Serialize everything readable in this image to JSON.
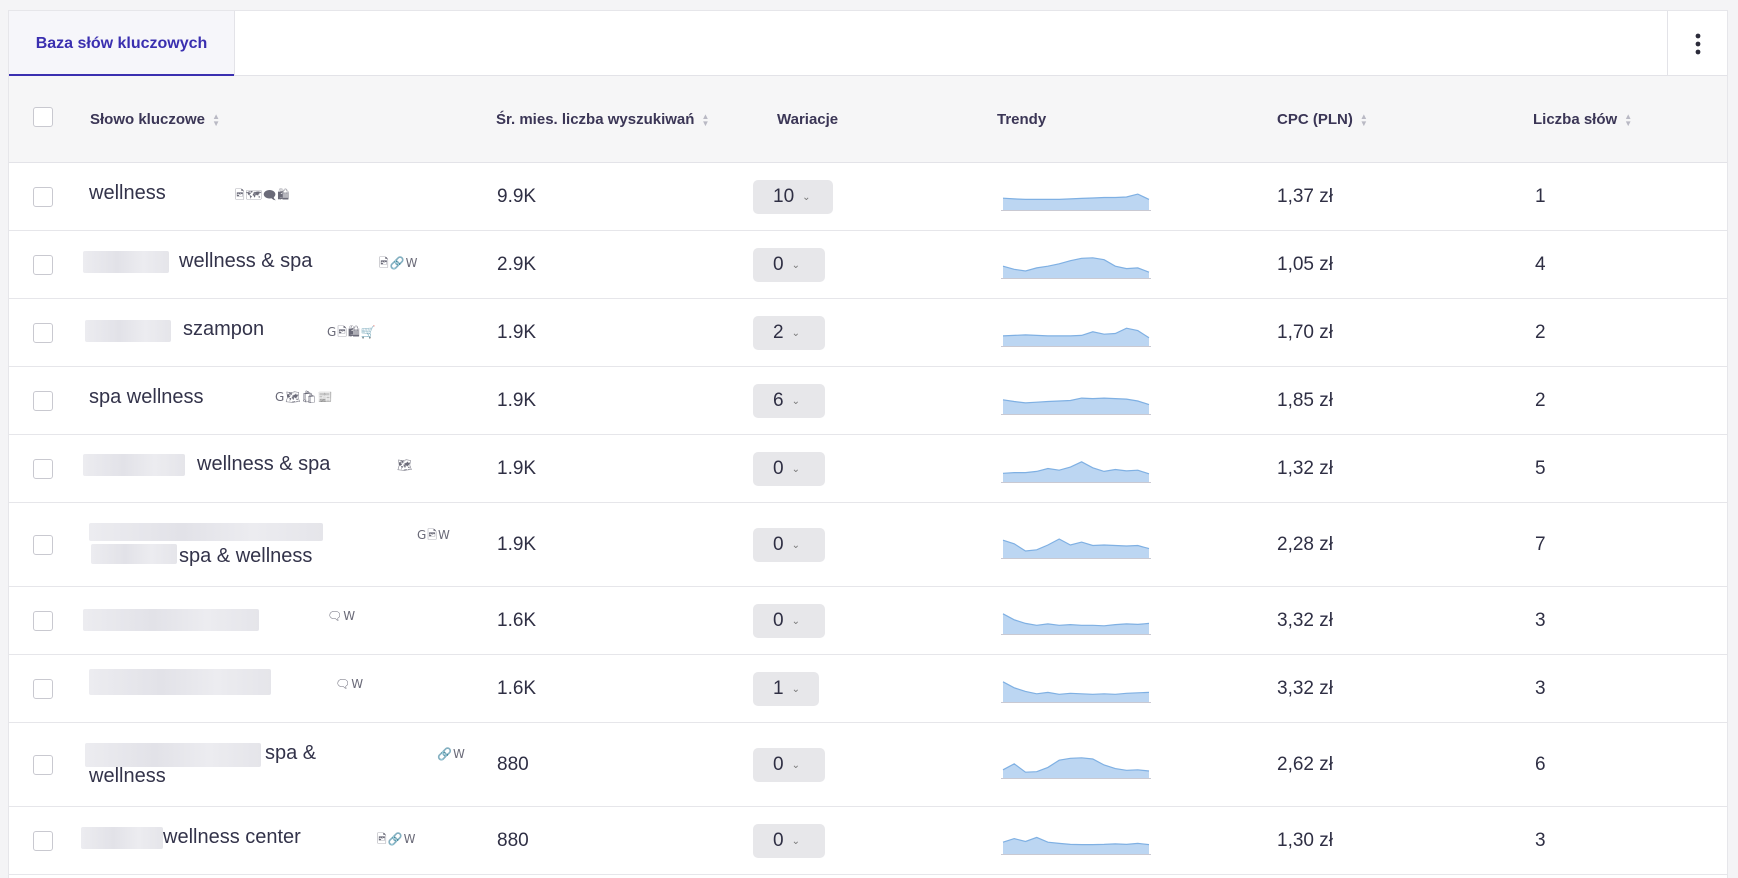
{
  "tab": {
    "label": "Baza słów kluczowych"
  },
  "columns": {
    "keyword": "Słowo kluczowe",
    "volume": "Śr. mies. liczba wyszukiwań",
    "variations": "Wariacje",
    "trends": "Trendy",
    "cpc": "CPC (PLN)",
    "words": "Liczba słów"
  },
  "colors": {
    "accent": "#3a2fb0",
    "trend_fill": "#bcd6f2",
    "trend_line": "#7fb0e3"
  },
  "rows": [
    {
      "keyword": "wellness",
      "icons": "🖻🗺🗨🛍",
      "volume": "9.9K",
      "variations": "10",
      "cpc": "1,37 zł",
      "words": "1",
      "trend": [
        0.45,
        0.42,
        0.4,
        0.4,
        0.4,
        0.4,
        0.42,
        0.44,
        0.46,
        0.48,
        0.48,
        0.5,
        0.62,
        0.4
      ]
    },
    {
      "keyword": "wellness & spa",
      "icons": "🖻🔗W",
      "volume": "2.9K",
      "variations": "0",
      "cpc": "1,05 zł",
      "words": "4",
      "trend": [
        0.45,
        0.32,
        0.25,
        0.38,
        0.45,
        0.55,
        0.68,
        0.78,
        0.8,
        0.72,
        0.45,
        0.35,
        0.38,
        0.2
      ]
    },
    {
      "keyword": "szampon",
      "icons": "G🖻🛍🛒",
      "volume": "1.9K",
      "variations": "2",
      "cpc": "1,70 zł",
      "words": "2",
      "trend": [
        0.38,
        0.4,
        0.42,
        0.4,
        0.38,
        0.38,
        0.38,
        0.4,
        0.55,
        0.45,
        0.48,
        0.7,
        0.6,
        0.3
      ]
    },
    {
      "keyword": "spa wellness",
      "icons": "G🗺🛍📰",
      "volume": "1.9K",
      "variations": "6",
      "cpc": "1,85 zł",
      "words": "2",
      "trend": [
        0.55,
        0.48,
        0.42,
        0.45,
        0.48,
        0.5,
        0.52,
        0.62,
        0.6,
        0.62,
        0.6,
        0.58,
        0.5,
        0.35
      ]
    },
    {
      "keyword": "wellness & spa",
      "icons": "🗺",
      "volume": "1.9K",
      "variations": "0",
      "cpc": "1,32 zł",
      "words": "5",
      "trend": [
        0.32,
        0.35,
        0.35,
        0.4,
        0.52,
        0.45,
        0.58,
        0.8,
        0.55,
        0.4,
        0.48,
        0.42,
        0.45,
        0.3
      ]
    },
    {
      "keyword": "spa & wellness",
      "icons": "G🖻W",
      "volume": "1.9K",
      "variations": "0",
      "cpc": "2,28 zł",
      "words": "7",
      "trend": [
        0.7,
        0.55,
        0.25,
        0.3,
        0.5,
        0.75,
        0.5,
        0.62,
        0.48,
        0.5,
        0.48,
        0.46,
        0.48,
        0.35
      ]
    },
    {
      "keyword": "",
      "icons": "🗨W",
      "volume": "1.6K",
      "variations": "0",
      "cpc": "3,32 zł",
      "words": "3",
      "trend": [
        0.8,
        0.55,
        0.4,
        0.32,
        0.38,
        0.32,
        0.35,
        0.32,
        0.32,
        0.3,
        0.35,
        0.38,
        0.36,
        0.4
      ]
    },
    {
      "keyword": "",
      "icons": "🗨W",
      "volume": "1.6K",
      "variations": "1",
      "cpc": "3,32 zł",
      "words": "3",
      "trend": [
        0.8,
        0.55,
        0.4,
        0.3,
        0.36,
        0.28,
        0.32,
        0.3,
        0.28,
        0.3,
        0.28,
        0.32,
        0.34,
        0.36
      ]
    },
    {
      "keyword": "spa & wellness",
      "icons": "🔗W",
      "volume": "880",
      "variations": "0",
      "cpc": "2,62 zł",
      "words": "6",
      "trend": [
        0.3,
        0.55,
        0.2,
        0.22,
        0.4,
        0.7,
        0.78,
        0.8,
        0.75,
        0.5,
        0.35,
        0.28,
        0.3,
        0.25
      ]
    },
    {
      "keyword": "wellness center",
      "icons": "🖻🔗W",
      "volume": "880",
      "variations": "0",
      "cpc": "1,30 zł",
      "words": "3",
      "trend": [
        0.45,
        0.6,
        0.48,
        0.65,
        0.45,
        0.4,
        0.36,
        0.35,
        0.35,
        0.36,
        0.38,
        0.36,
        0.4,
        0.35
      ]
    }
  ]
}
